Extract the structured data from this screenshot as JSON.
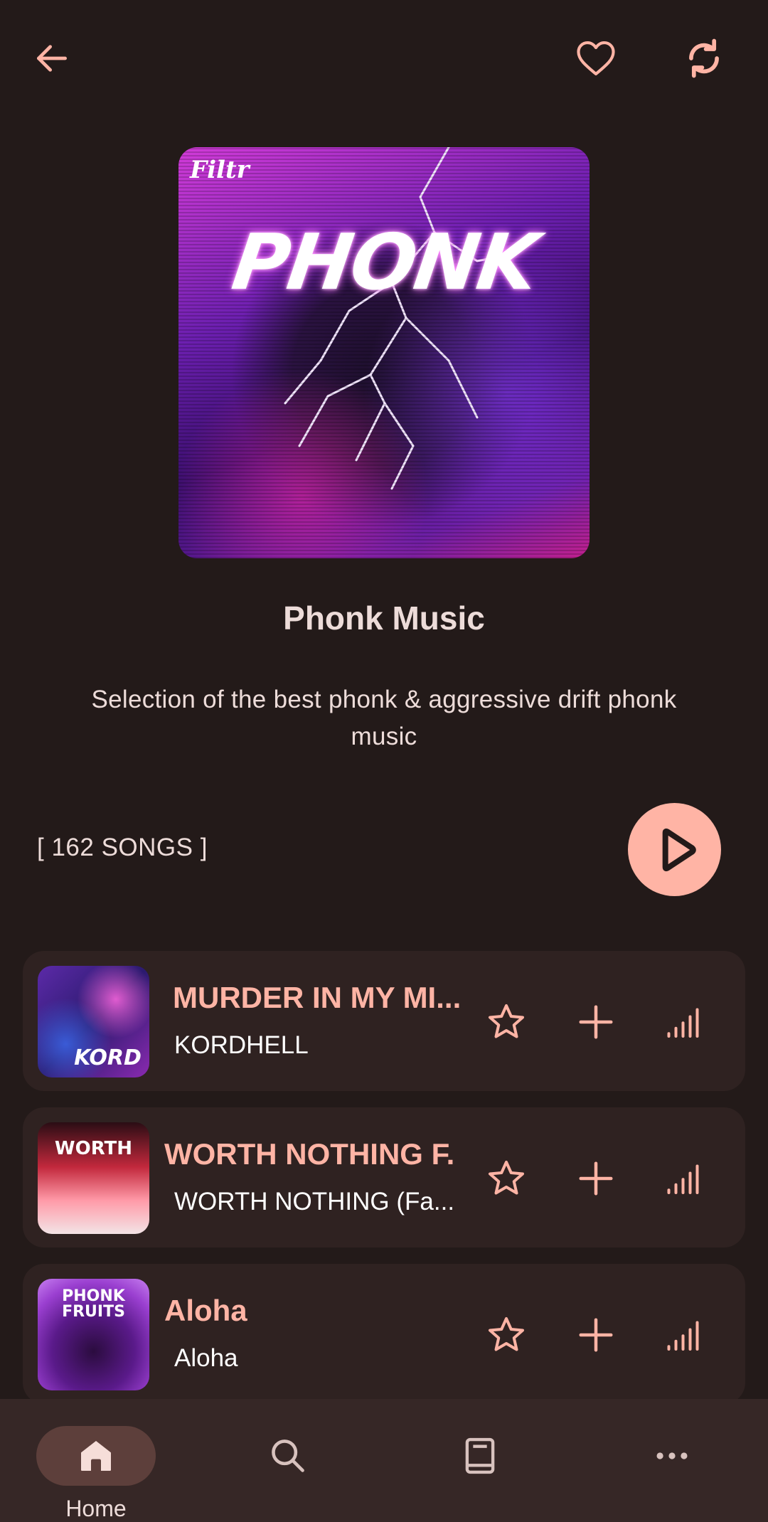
{
  "colors": {
    "background": "#231a19",
    "accent": "#ffb4a5",
    "card": "#2f2221",
    "navbar": "#362726",
    "nav_active": "#5d3f3b"
  },
  "topbar": {
    "back_icon": "arrow-left-icon",
    "favorite_icon": "heart-icon",
    "sync_icon": "sync-icon"
  },
  "playlist": {
    "cover_brand": "Filtr",
    "cover_word": "PHONK",
    "title": "Phonk Music",
    "description": "Selection of the best phonk & aggressive drift phonk music",
    "song_count": "[ 162 SONGS ]",
    "play_icon": "play-icon"
  },
  "songs": [
    {
      "title": "MURDER IN MY MI...",
      "artist": "KORDHELL",
      "art_text": "KORD"
    },
    {
      "title": "WORTH NOTHING F...",
      "artist": "WORTH NOTHING (Fa...",
      "art_text": "WORTH"
    },
    {
      "title": "Aloha",
      "artist": "Aloha",
      "art_text": "PHONK FRUITS"
    }
  ],
  "song_actions": [
    "star-icon",
    "add-icon",
    "signal-icon"
  ],
  "nav": {
    "items": [
      {
        "icon": "home-icon",
        "label": "Home",
        "active": true
      },
      {
        "icon": "search-icon",
        "label": "",
        "active": false
      },
      {
        "icon": "library-icon",
        "label": "",
        "active": false
      },
      {
        "icon": "more-icon",
        "label": "",
        "active": false
      }
    ]
  }
}
